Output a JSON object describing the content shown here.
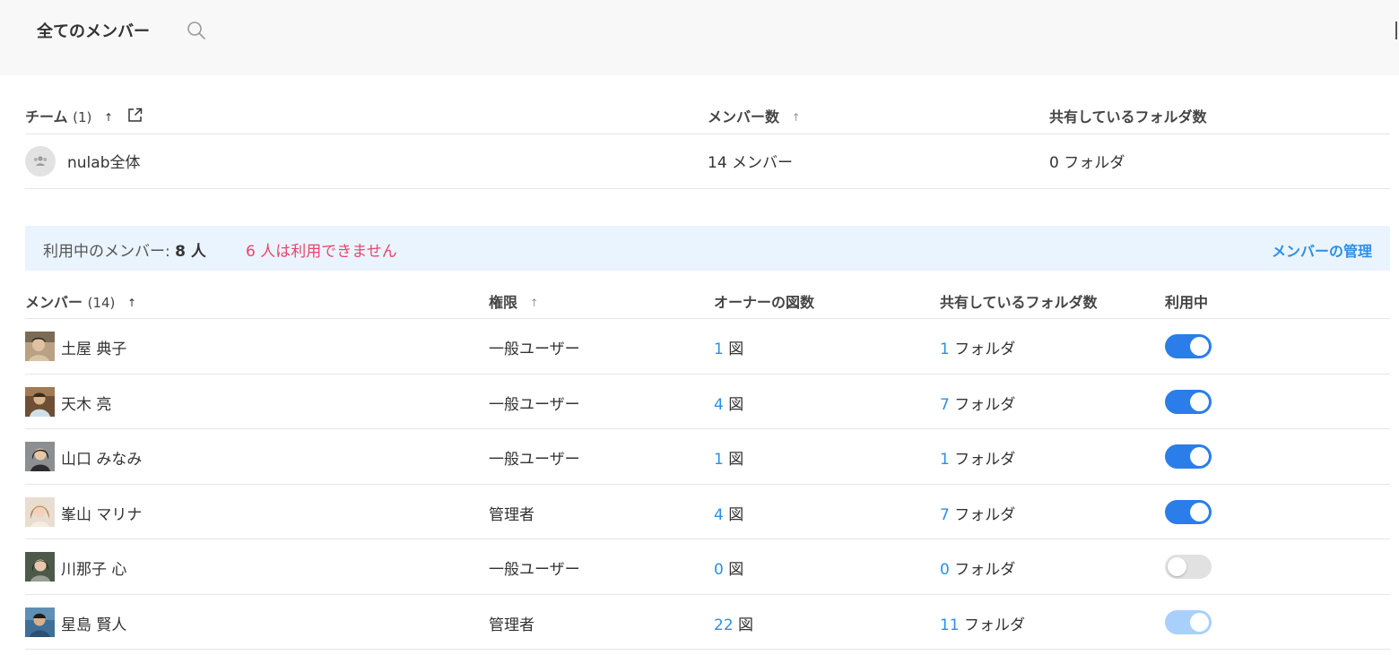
{
  "header": {
    "title": "全てのメンバー",
    "search_icon": "search-icon"
  },
  "teams": {
    "columns": {
      "team": "チーム",
      "team_count": "(1)",
      "members": "メンバー数",
      "folders": "共有しているフォルダ数"
    },
    "rows": [
      {
        "name": "nulab全体",
        "members": "14 メンバー",
        "folders": "0 フォルダ"
      }
    ]
  },
  "banner": {
    "usage_label": "利用中のメンバー: ",
    "usage_count": "8 人",
    "warning": "6 人は利用できません",
    "manage_link": "メンバーの管理"
  },
  "members": {
    "columns": {
      "member": "メンバー",
      "member_count": "(14)",
      "role": "権限",
      "owner_diagrams": "オーナーの図数",
      "shared_folders": "共有しているフォルダ数",
      "active": "利用中"
    },
    "rows": [
      {
        "name": "土屋 典子",
        "role": "一般ユーザー",
        "diagrams": "1",
        "diagram_unit": "図",
        "folders": "1",
        "folder_unit": "フォルダ",
        "active": true
      },
      {
        "name": "天木 亮",
        "role": "一般ユーザー",
        "diagrams": "4",
        "diagram_unit": "図",
        "folders": "7",
        "folder_unit": "フォルダ",
        "active": true
      },
      {
        "name": "山口 みなみ",
        "role": "一般ユーザー",
        "diagrams": "1",
        "diagram_unit": "図",
        "folders": "1",
        "folder_unit": "フォルダ",
        "active": true
      },
      {
        "name": "峯山 マリナ",
        "role": "管理者",
        "diagrams": "4",
        "diagram_unit": "図",
        "folders": "7",
        "folder_unit": "フォルダ",
        "active": true
      },
      {
        "name": "川那子 心",
        "role": "一般ユーザー",
        "diagrams": "0",
        "diagram_unit": "図",
        "folders": "0",
        "folder_unit": "フォルダ",
        "active": false
      },
      {
        "name": "星島 賢人",
        "role": "管理者",
        "diagrams": "22",
        "diagram_unit": "図",
        "folders": "11",
        "folder_unit": "フォルダ",
        "active": true,
        "toggle_state": "disabled"
      }
    ]
  },
  "colors": {
    "accent": "#2d8fe6",
    "toggle_on": "#2b7de9",
    "toggle_disabled": "#a9d0fb",
    "warning": "#e8456b",
    "banner_bg": "#eaf4ff"
  }
}
